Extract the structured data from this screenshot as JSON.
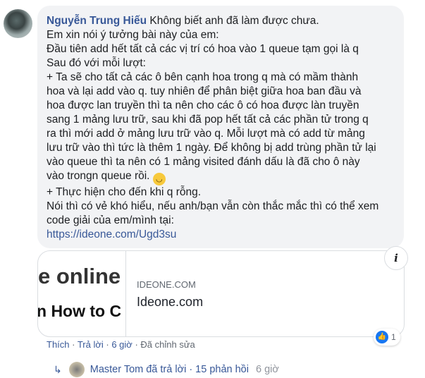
{
  "comment": {
    "author": "Nguyễn Trung Hiếu",
    "lines": [
      " Không biết anh đã làm được chưa.",
      "Em xin nói ý tưởng bài này của em:",
      "Đầu tiên add hết tất cả các vị trí có hoa vào 1 queue tạm gọi là q",
      "Sau đó với mỗi lượt:",
      "+ Ta sẽ cho tất cả các ô bên cạnh hoa trong q mà có mầm thành",
      "hoa và lại add vào q. tuy nhiên để phân biệt giữa hoa ban đầu và",
      "hoa được lan truyền thì ta nên cho các ô có hoa được làn truyền",
      "sang 1 mảng lưu trữ, sau khi đã pop hết tất cả các phần tử trong q",
      "ra thì mới add ở mảng lưu trữ vào q. Mỗi lượt mà có add từ mảng",
      "lưu trữ vào thì tức là thêm 1 ngày. Để không bị add trùng phần tử lại",
      "vào queue thì ta nên có 1 mảng visited đánh dấu là đã cho ô này",
      "vào trongn queue rồi. ",
      "+ Thực hiện cho đến khi q rỗng.",
      "Nói thì có vẻ khó hiểu, nếu anh/bạn vẫn còn thắc mắc thì có thể xem",
      "code giải của em/mình tại:"
    ],
    "emoji": "smiley-emoji",
    "url": "https://ideone.com/Ugd3su"
  },
  "card": {
    "thumb_line1": "e online",
    "thumb_line2": "n How to C",
    "domain": "IDEONE.COM",
    "title": "Ideone.com",
    "info": "i"
  },
  "reactions": {
    "count": "1",
    "icon": "like-icon",
    "color": "#1877f2"
  },
  "actions": {
    "like": "Thích",
    "reply": "Trả lời",
    "time": "6 giờ",
    "edited": "Đã chỉnh sửa",
    "sep": " · "
  },
  "replies": {
    "text": "Master Tom đã trả lời · 15 phản hồi",
    "time": "6 giờ"
  }
}
